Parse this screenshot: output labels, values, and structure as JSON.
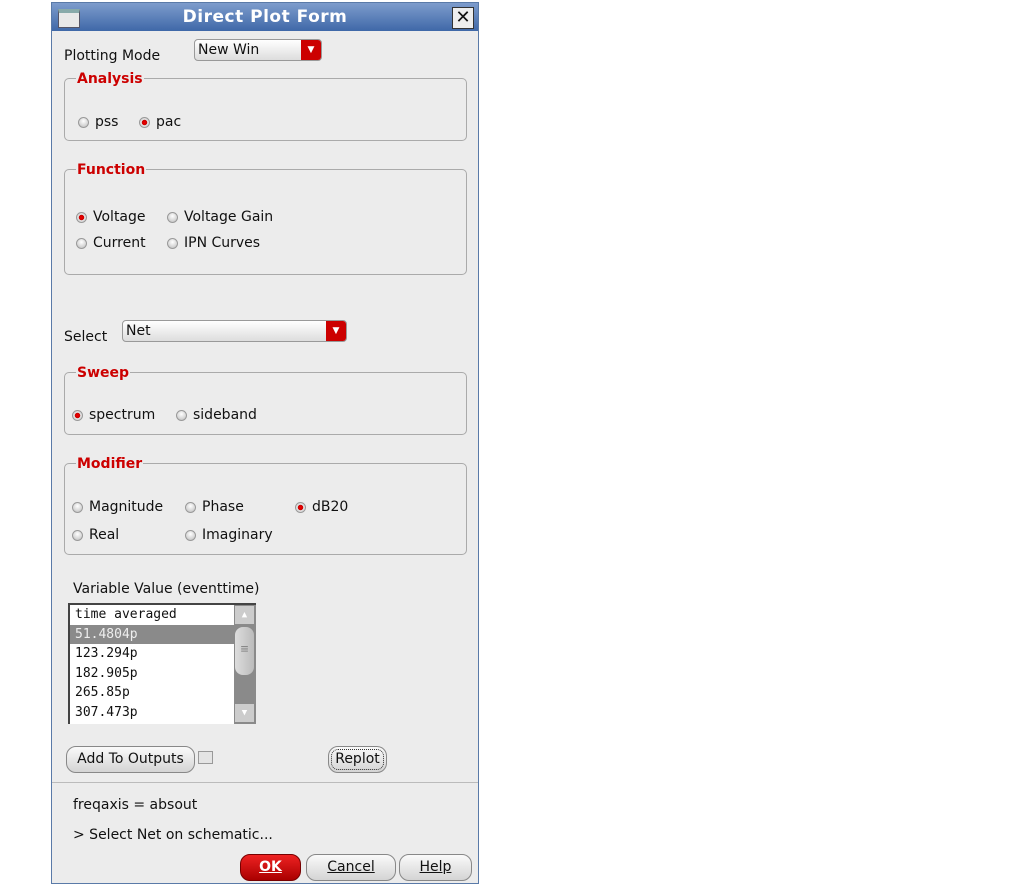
{
  "window": {
    "title": "Direct Plot Form"
  },
  "plotting_mode": {
    "label": "Plotting Mode",
    "value": "New Win"
  },
  "analysis": {
    "legend": "Analysis",
    "options": [
      {
        "label": "pss",
        "selected": false
      },
      {
        "label": "pac",
        "selected": true
      }
    ]
  },
  "function": {
    "legend": "Function",
    "options": [
      {
        "label": "Voltage",
        "selected": true
      },
      {
        "label": "Voltage Gain",
        "selected": false
      },
      {
        "label": "Current",
        "selected": false
      },
      {
        "label": "IPN Curves",
        "selected": false
      }
    ]
  },
  "select": {
    "label": "Select",
    "value": "Net"
  },
  "sweep": {
    "legend": "Sweep",
    "options": [
      {
        "label": "spectrum",
        "selected": true
      },
      {
        "label": "sideband",
        "selected": false
      }
    ]
  },
  "modifier": {
    "legend": "Modifier",
    "options": [
      {
        "label": "Magnitude",
        "selected": false
      },
      {
        "label": "Phase",
        "selected": false
      },
      {
        "label": "dB20",
        "selected": true
      },
      {
        "label": "Real",
        "selected": false
      },
      {
        "label": "Imaginary",
        "selected": false
      }
    ]
  },
  "variable": {
    "label": "Variable Value (eventtime)",
    "items": [
      "time averaged",
      "51.4804p",
      "123.294p",
      "182.905p",
      "265.85p",
      "307.473p"
    ],
    "selected_index": 1
  },
  "buttons": {
    "add_outputs": "Add To Outputs",
    "replot": "Replot",
    "ok": "OK",
    "cancel": "Cancel",
    "help": "Help"
  },
  "status": {
    "freqaxis": "freqaxis = absout",
    "prompt": "> Select Net on schematic..."
  }
}
